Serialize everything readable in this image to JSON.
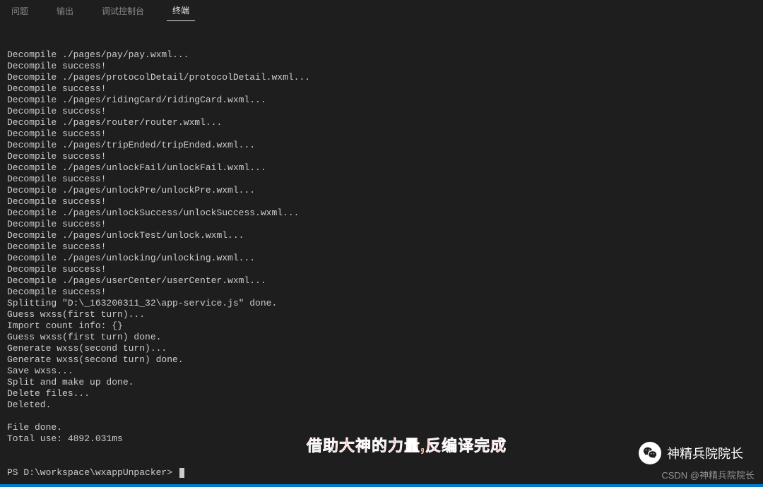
{
  "tabs": {
    "problems": "问题",
    "output": "输出",
    "debug": "调试控制台",
    "terminal": "终端"
  },
  "terminal_lines": [
    "Decompile ./pages/pay/pay.wxml...",
    "Decompile success!",
    "Decompile ./pages/protocolDetail/protocolDetail.wxml...",
    "Decompile success!",
    "Decompile ./pages/ridingCard/ridingCard.wxml...",
    "Decompile success!",
    "Decompile ./pages/router/router.wxml...",
    "Decompile success!",
    "Decompile ./pages/tripEnded/tripEnded.wxml...",
    "Decompile success!",
    "Decompile ./pages/unlockFail/unlockFail.wxml...",
    "Decompile success!",
    "Decompile ./pages/unlockPre/unlockPre.wxml...",
    "Decompile success!",
    "Decompile ./pages/unlockSuccess/unlockSuccess.wxml...",
    "Decompile success!",
    "Decompile ./pages/unlockTest/unlock.wxml...",
    "Decompile success!",
    "Decompile ./pages/unlocking/unlocking.wxml...",
    "Decompile success!",
    "Decompile ./pages/userCenter/userCenter.wxml...",
    "Decompile success!",
    "Splitting \"D:\\_163200311_32\\app-service.js\" done.",
    "Guess wxss(first turn)...",
    "Import count info: {}",
    "Guess wxss(first turn) done.",
    "Generate wxss(second turn)...",
    "Generate wxss(second turn) done.",
    "Save wxss...",
    "Split and make up done.",
    "Delete files...",
    "Deleted.",
    "",
    "File done.",
    "Total use: 4892.031ms"
  ],
  "prompt": "PS D:\\workspace\\wxappUnpacker> ",
  "overlay_caption": "借助大神的力量,反编译完成",
  "wechat_label": "神精兵院院长",
  "csdn_watermark": "CSDN @神精兵院院长"
}
